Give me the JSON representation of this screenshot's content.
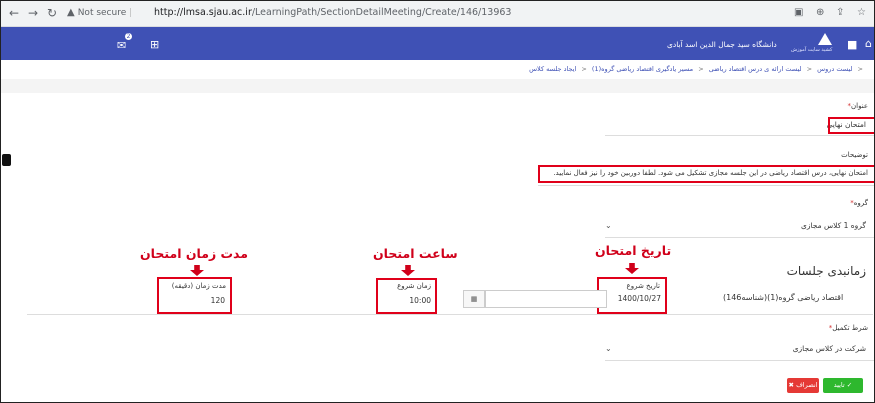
{
  "browser": {
    "security_label": "Not secure",
    "url_host": "http://lmsa.sjau.ac.ir",
    "url_path": "/LearningPath/SectionDetailMeeting/Create/146/13963"
  },
  "header": {
    "university_name": "دانشگاه سید جمال الدین اسد آبادی",
    "university_sub": "کشید سایت آموزش"
  },
  "breadcrumb": [
    "لیست دروس",
    "لیست ارائه ی درس اقتصاد ریاضی",
    "مسیر یادگیری اقتصاد ریاضی گروه(1)",
    "ایجاد جلسه کلاس"
  ],
  "form": {
    "title_label": "عنوان",
    "title_value": "امتحان نهایی",
    "desc_label": "توضیحات",
    "desc_value": "امتحان نهایی، درس اقتصاد ریاضی در این جلسه مجازی تشکیل می شود. لطفا دوربین خود را نیز فعال نمایید.",
    "group_label": "گروه",
    "group_value": "گروه 1 کلاس مجازی",
    "schedule_title": "زمانبدی جلسات",
    "meeting_name": "اقتصاد ریاضی گروه(1)(شناسه146)",
    "start_date_label": "تاریخ شروع",
    "start_date_value": "1400/10/27",
    "start_time_label": "زمان شروع",
    "start_time_value": "10:00",
    "duration_label": "مدت زمان (دقیقه)",
    "duration_value": "120",
    "completion_label": "شرط تکمیل",
    "completion_value": "شرکت در کلاس مجازی",
    "ok_button": "تایید",
    "cancel_button": "انصراف"
  },
  "annotations": {
    "exam_date": "تاریخ امتحان",
    "exam_time": "ساعت امتحان",
    "exam_duration": "مدت زمان امتحان"
  },
  "colors": {
    "accent": "#3f51b5",
    "annotation": "#d0001a",
    "ok": "#2eb82e",
    "cancel": "#e53935"
  }
}
